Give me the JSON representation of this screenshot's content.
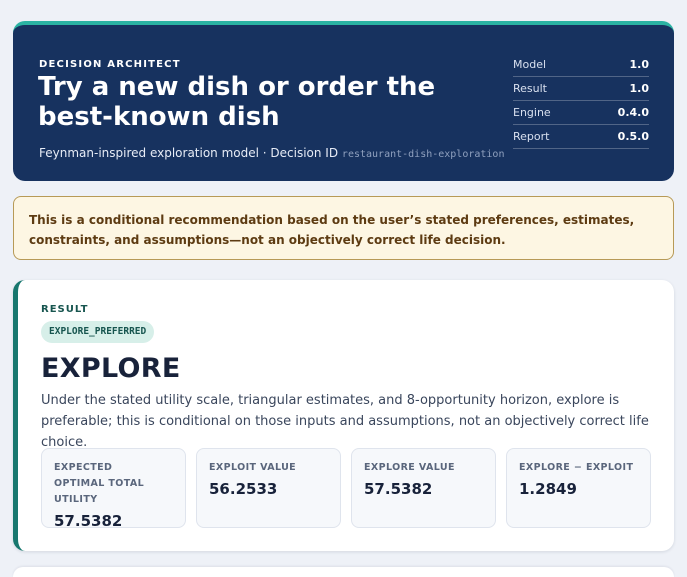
{
  "header": {
    "eyebrow": "DECISION ARCHITECT",
    "title": "Try a new dish or order the best-known dish",
    "subtitle_text": "Feynman-inspired exploration model · Decision ID",
    "decision_id": "restaurant-dish-exploration",
    "versions": [
      {
        "key": "Model",
        "value": "1.0"
      },
      {
        "key": "Result",
        "value": "1.0"
      },
      {
        "key": "Engine",
        "value": "0.4.0"
      },
      {
        "key": "Report",
        "value": "0.5.0"
      }
    ]
  },
  "notice": {
    "text": "This is a conditional recommendation based on the user’s stated preferences, estimates, constraints, and assumptions—not an objectively correct life decision."
  },
  "result": {
    "label": "RESULT",
    "badge": "EXPLORE_PREFERRED",
    "decision": "EXPLORE",
    "explanation": "Under the stated utility scale, triangular estimates, and 8-opportunity horizon, explore is preferable; this is conditional on those inputs and assumptions, not an objectively correct life choice.",
    "metrics": [
      {
        "label": "EXPECTED OPTIMAL TOTAL UTILITY",
        "value": "57.5382"
      },
      {
        "label": "EXPLOIT VALUE",
        "value": "56.2533"
      },
      {
        "label": "EXPLORE VALUE",
        "value": "57.5382"
      },
      {
        "label": "EXPLORE − EXPLOIT",
        "value": "1.2849"
      }
    ]
  },
  "colors": {
    "hero_bg": "#17325f",
    "accent_teal": "#2bb3a3",
    "notice_bg": "#fdf6e3",
    "notice_border": "#b79a57",
    "result_accent": "#17776e"
  }
}
